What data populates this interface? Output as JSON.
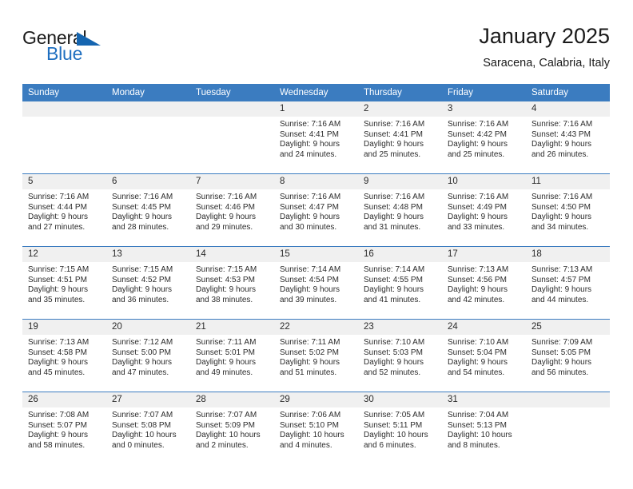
{
  "logo": {
    "word_one": "General",
    "word_two": "Blue",
    "triangle": "triangle-mark"
  },
  "header": {
    "title": "January 2025",
    "subtitle": "Saracena, Calabria, Italy"
  },
  "colors": {
    "header_blue": "#3b7cc0",
    "daynum_band": "#f0f0f0",
    "logo_blue": "#1f6fc0",
    "text": "#2b2b2b"
  },
  "weekday_headers": [
    "Sunday",
    "Monday",
    "Tuesday",
    "Wednesday",
    "Thursday",
    "Friday",
    "Saturday"
  ],
  "weeks": [
    [
      {
        "day": "",
        "sunrise": "",
        "sunset": "",
        "daylight_line1": "",
        "daylight_line2": ""
      },
      {
        "day": "",
        "sunrise": "",
        "sunset": "",
        "daylight_line1": "",
        "daylight_line2": ""
      },
      {
        "day": "",
        "sunrise": "",
        "sunset": "",
        "daylight_line1": "",
        "daylight_line2": ""
      },
      {
        "day": "1",
        "sunrise": "Sunrise: 7:16 AM",
        "sunset": "Sunset: 4:41 PM",
        "daylight_line1": "Daylight: 9 hours",
        "daylight_line2": "and 24 minutes."
      },
      {
        "day": "2",
        "sunrise": "Sunrise: 7:16 AM",
        "sunset": "Sunset: 4:41 PM",
        "daylight_line1": "Daylight: 9 hours",
        "daylight_line2": "and 25 minutes."
      },
      {
        "day": "3",
        "sunrise": "Sunrise: 7:16 AM",
        "sunset": "Sunset: 4:42 PM",
        "daylight_line1": "Daylight: 9 hours",
        "daylight_line2": "and 25 minutes."
      },
      {
        "day": "4",
        "sunrise": "Sunrise: 7:16 AM",
        "sunset": "Sunset: 4:43 PM",
        "daylight_line1": "Daylight: 9 hours",
        "daylight_line2": "and 26 minutes."
      }
    ],
    [
      {
        "day": "5",
        "sunrise": "Sunrise: 7:16 AM",
        "sunset": "Sunset: 4:44 PM",
        "daylight_line1": "Daylight: 9 hours",
        "daylight_line2": "and 27 minutes."
      },
      {
        "day": "6",
        "sunrise": "Sunrise: 7:16 AM",
        "sunset": "Sunset: 4:45 PM",
        "daylight_line1": "Daylight: 9 hours",
        "daylight_line2": "and 28 minutes."
      },
      {
        "day": "7",
        "sunrise": "Sunrise: 7:16 AM",
        "sunset": "Sunset: 4:46 PM",
        "daylight_line1": "Daylight: 9 hours",
        "daylight_line2": "and 29 minutes."
      },
      {
        "day": "8",
        "sunrise": "Sunrise: 7:16 AM",
        "sunset": "Sunset: 4:47 PM",
        "daylight_line1": "Daylight: 9 hours",
        "daylight_line2": "and 30 minutes."
      },
      {
        "day": "9",
        "sunrise": "Sunrise: 7:16 AM",
        "sunset": "Sunset: 4:48 PM",
        "daylight_line1": "Daylight: 9 hours",
        "daylight_line2": "and 31 minutes."
      },
      {
        "day": "10",
        "sunrise": "Sunrise: 7:16 AM",
        "sunset": "Sunset: 4:49 PM",
        "daylight_line1": "Daylight: 9 hours",
        "daylight_line2": "and 33 minutes."
      },
      {
        "day": "11",
        "sunrise": "Sunrise: 7:16 AM",
        "sunset": "Sunset: 4:50 PM",
        "daylight_line1": "Daylight: 9 hours",
        "daylight_line2": "and 34 minutes."
      }
    ],
    [
      {
        "day": "12",
        "sunrise": "Sunrise: 7:15 AM",
        "sunset": "Sunset: 4:51 PM",
        "daylight_line1": "Daylight: 9 hours",
        "daylight_line2": "and 35 minutes."
      },
      {
        "day": "13",
        "sunrise": "Sunrise: 7:15 AM",
        "sunset": "Sunset: 4:52 PM",
        "daylight_line1": "Daylight: 9 hours",
        "daylight_line2": "and 36 minutes."
      },
      {
        "day": "14",
        "sunrise": "Sunrise: 7:15 AM",
        "sunset": "Sunset: 4:53 PM",
        "daylight_line1": "Daylight: 9 hours",
        "daylight_line2": "and 38 minutes."
      },
      {
        "day": "15",
        "sunrise": "Sunrise: 7:14 AM",
        "sunset": "Sunset: 4:54 PM",
        "daylight_line1": "Daylight: 9 hours",
        "daylight_line2": "and 39 minutes."
      },
      {
        "day": "16",
        "sunrise": "Sunrise: 7:14 AM",
        "sunset": "Sunset: 4:55 PM",
        "daylight_line1": "Daylight: 9 hours",
        "daylight_line2": "and 41 minutes."
      },
      {
        "day": "17",
        "sunrise": "Sunrise: 7:13 AM",
        "sunset": "Sunset: 4:56 PM",
        "daylight_line1": "Daylight: 9 hours",
        "daylight_line2": "and 42 minutes."
      },
      {
        "day": "18",
        "sunrise": "Sunrise: 7:13 AM",
        "sunset": "Sunset: 4:57 PM",
        "daylight_line1": "Daylight: 9 hours",
        "daylight_line2": "and 44 minutes."
      }
    ],
    [
      {
        "day": "19",
        "sunrise": "Sunrise: 7:13 AM",
        "sunset": "Sunset: 4:58 PM",
        "daylight_line1": "Daylight: 9 hours",
        "daylight_line2": "and 45 minutes."
      },
      {
        "day": "20",
        "sunrise": "Sunrise: 7:12 AM",
        "sunset": "Sunset: 5:00 PM",
        "daylight_line1": "Daylight: 9 hours",
        "daylight_line2": "and 47 minutes."
      },
      {
        "day": "21",
        "sunrise": "Sunrise: 7:11 AM",
        "sunset": "Sunset: 5:01 PM",
        "daylight_line1": "Daylight: 9 hours",
        "daylight_line2": "and 49 minutes."
      },
      {
        "day": "22",
        "sunrise": "Sunrise: 7:11 AM",
        "sunset": "Sunset: 5:02 PM",
        "daylight_line1": "Daylight: 9 hours",
        "daylight_line2": "and 51 minutes."
      },
      {
        "day": "23",
        "sunrise": "Sunrise: 7:10 AM",
        "sunset": "Sunset: 5:03 PM",
        "daylight_line1": "Daylight: 9 hours",
        "daylight_line2": "and 52 minutes."
      },
      {
        "day": "24",
        "sunrise": "Sunrise: 7:10 AM",
        "sunset": "Sunset: 5:04 PM",
        "daylight_line1": "Daylight: 9 hours",
        "daylight_line2": "and 54 minutes."
      },
      {
        "day": "25",
        "sunrise": "Sunrise: 7:09 AM",
        "sunset": "Sunset: 5:05 PM",
        "daylight_line1": "Daylight: 9 hours",
        "daylight_line2": "and 56 minutes."
      }
    ],
    [
      {
        "day": "26",
        "sunrise": "Sunrise: 7:08 AM",
        "sunset": "Sunset: 5:07 PM",
        "daylight_line1": "Daylight: 9 hours",
        "daylight_line2": "and 58 minutes."
      },
      {
        "day": "27",
        "sunrise": "Sunrise: 7:07 AM",
        "sunset": "Sunset: 5:08 PM",
        "daylight_line1": "Daylight: 10 hours",
        "daylight_line2": "and 0 minutes."
      },
      {
        "day": "28",
        "sunrise": "Sunrise: 7:07 AM",
        "sunset": "Sunset: 5:09 PM",
        "daylight_line1": "Daylight: 10 hours",
        "daylight_line2": "and 2 minutes."
      },
      {
        "day": "29",
        "sunrise": "Sunrise: 7:06 AM",
        "sunset": "Sunset: 5:10 PM",
        "daylight_line1": "Daylight: 10 hours",
        "daylight_line2": "and 4 minutes."
      },
      {
        "day": "30",
        "sunrise": "Sunrise: 7:05 AM",
        "sunset": "Sunset: 5:11 PM",
        "daylight_line1": "Daylight: 10 hours",
        "daylight_line2": "and 6 minutes."
      },
      {
        "day": "31",
        "sunrise": "Sunrise: 7:04 AM",
        "sunset": "Sunset: 5:13 PM",
        "daylight_line1": "Daylight: 10 hours",
        "daylight_line2": "and 8 minutes."
      },
      {
        "day": "",
        "sunrise": "",
        "sunset": "",
        "daylight_line1": "",
        "daylight_line2": ""
      }
    ]
  ]
}
